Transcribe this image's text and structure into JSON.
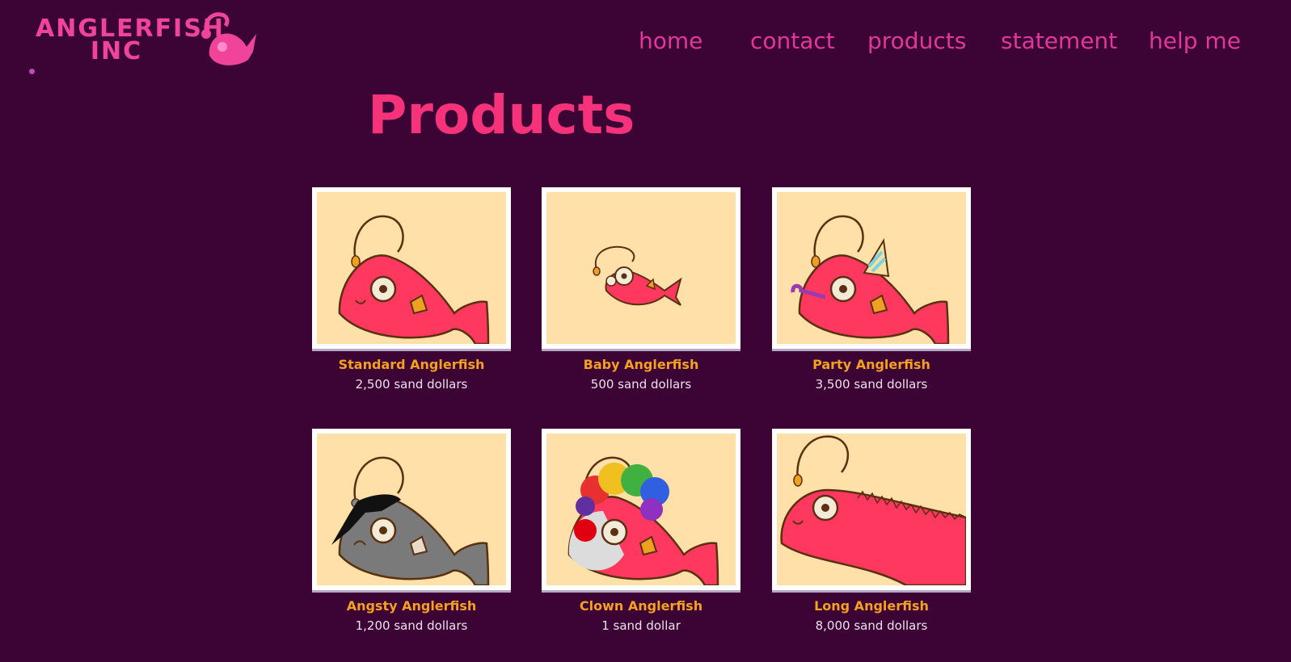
{
  "header": {
    "logo": {
      "line1": "ANGLERFISH",
      "line2": "INC"
    },
    "nav": [
      "home",
      "contact",
      "products",
      "statement",
      "help me"
    ]
  },
  "page": {
    "title": "Products"
  },
  "products": [
    {
      "name": "Standard Anglerfish",
      "price": "2,500 sand dollars",
      "icon": "standard-anglerfish-image"
    },
    {
      "name": "Baby Anglerfish",
      "price": "500 sand dollars",
      "icon": "baby-anglerfish-image"
    },
    {
      "name": "Party Anglerfish",
      "price": "3,500 sand dollars",
      "icon": "party-anglerfish-image"
    },
    {
      "name": "Angsty Anglerfish",
      "price": "1,200 sand dollars",
      "icon": "angsty-anglerfish-image"
    },
    {
      "name": "Clown Anglerfish",
      "price": "1 sand dollar",
      "icon": "clown-anglerfish-image"
    },
    {
      "name": "Long Anglerfish",
      "price": "8,000 sand dollars",
      "icon": "long-anglerfish-image"
    }
  ],
  "colors": {
    "background": "#3b0435",
    "accent": "#f5327a",
    "nav": "#e0389a",
    "product_name": "#f5a020",
    "card_bg": "#ffe0a8"
  }
}
